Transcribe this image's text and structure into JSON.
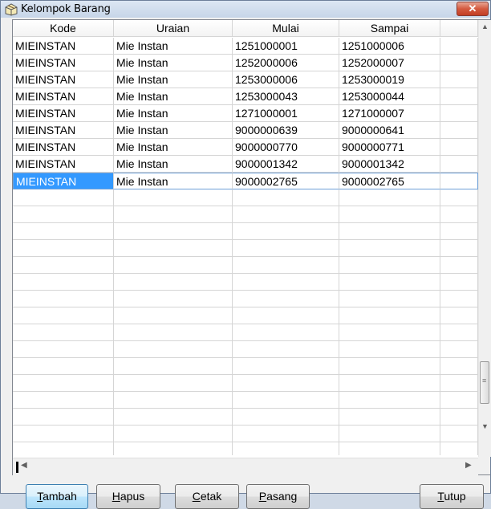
{
  "window": {
    "title": "Kelompok Barang",
    "close_symbol": "✕",
    "icon": "app-icon"
  },
  "grid": {
    "columns": [
      "Kode",
      "Uraian",
      "Mulai",
      "Sampai",
      ""
    ],
    "rows": [
      [
        "MIEINSTAN",
        "Mie Instan",
        "1251000001",
        "1251000006"
      ],
      [
        "MIEINSTAN",
        "Mie Instan",
        "1252000006",
        "1252000007"
      ],
      [
        "MIEINSTAN",
        "Mie Instan",
        "1253000006",
        "1253000019"
      ],
      [
        "MIEINSTAN",
        "Mie Instan",
        "1253000043",
        "1253000044"
      ],
      [
        "MIEINSTAN",
        "Mie Instan",
        "1271000001",
        "1271000007"
      ],
      [
        "MIEINSTAN",
        "Mie Instan",
        "9000000639",
        "9000000641"
      ],
      [
        "MIEINSTAN",
        "Mie Instan",
        "9000000770",
        "9000000771"
      ],
      [
        "MIEINSTAN",
        "Mie Instan",
        "9000001342",
        "9000001342"
      ],
      [
        "MIEINSTAN",
        "Mie Instan",
        "9000002765",
        "9000002765"
      ]
    ],
    "selected_row": 8,
    "selection_color": "#3399ff"
  },
  "buttons": {
    "tambah": {
      "u": "T",
      "rest": "ambah"
    },
    "hapus": {
      "u": "H",
      "rest": "apus"
    },
    "cetak": {
      "u": "C",
      "rest": "etak"
    },
    "pasang": {
      "u": "P",
      "rest": "asang"
    },
    "tutup": {
      "u": "T",
      "rest": "utup"
    }
  }
}
